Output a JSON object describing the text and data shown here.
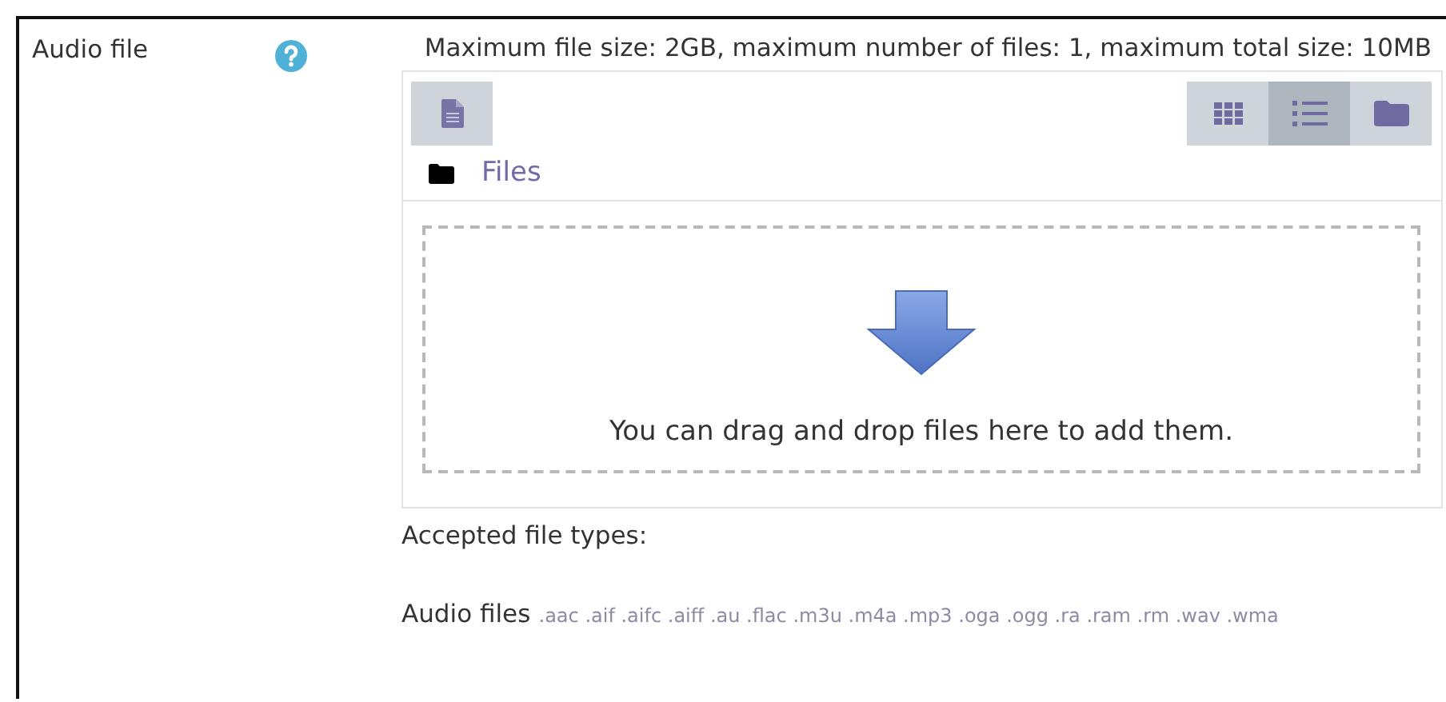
{
  "field": {
    "label": "Audio file",
    "limits": "Maximum file size: 2GB, maximum number of files: 1, maximum total size: 10MB"
  },
  "filepicker": {
    "view_modes": [
      {
        "kind": "icons",
        "selected": false
      },
      {
        "kind": "list",
        "selected": true
      },
      {
        "kind": "tree",
        "selected": false
      }
    ],
    "path": "Files",
    "drop_message": "You can drag and drop files here to add them."
  },
  "accepted": {
    "heading": "Accepted file types:",
    "group": "Audio files",
    "extensions": ".aac .aif .aifc .aiff .au .flac .m3u .m4a .mp3 .oga .ogg .ra .ram .rm .wav .wma"
  }
}
